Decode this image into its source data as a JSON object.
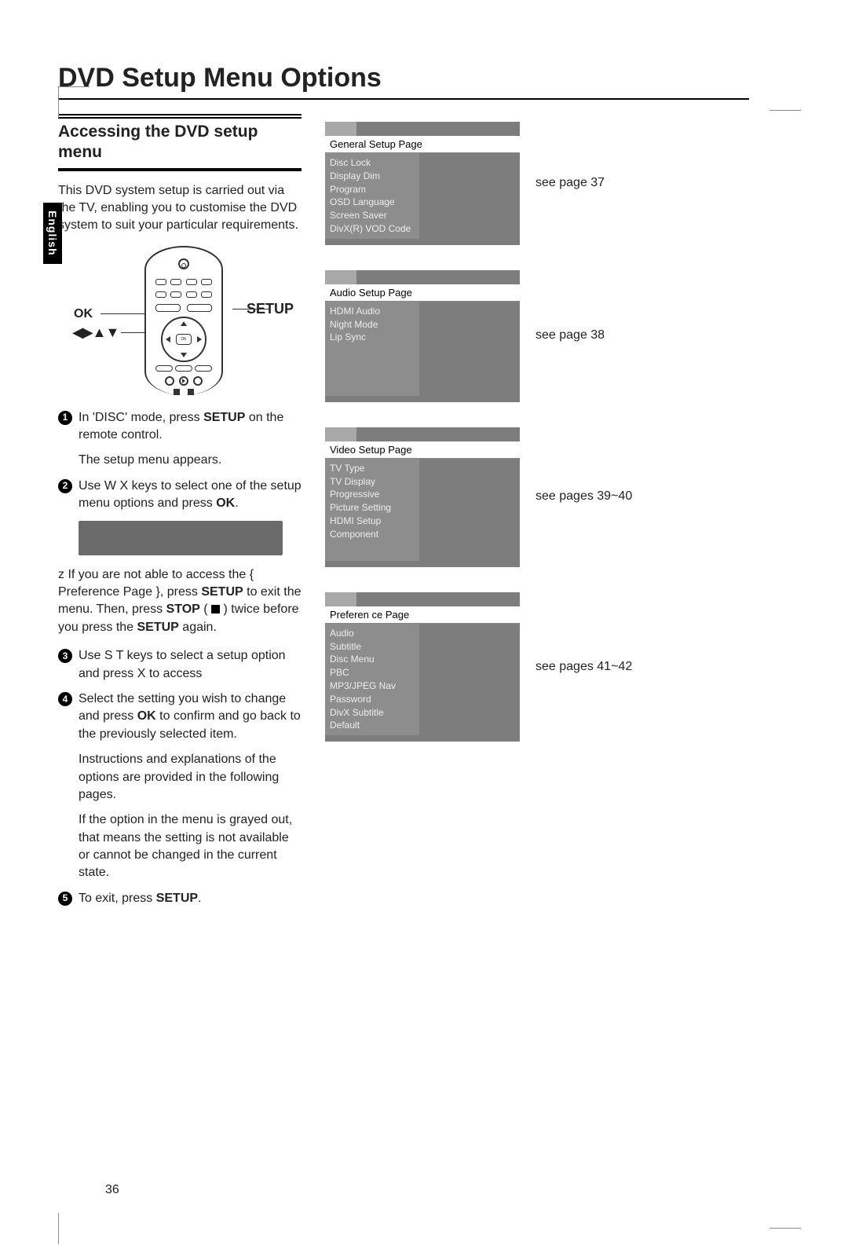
{
  "page_title": "DVD Setup Menu Options",
  "language_tab": "English",
  "section_heading": "Accessing the DVD setup menu",
  "intro": "This DVD system setup is carried out via the TV, enabling you to customise the DVD system to suit your particular requirements.",
  "remote_labels": {
    "ok": "OK",
    "setup": "SETUP",
    "arrows": "◀▶▲▼"
  },
  "steps": {
    "s1a": "In 'DISC' mode, press ",
    "s1b": "SETUP",
    "s1c": " on the remote control.",
    "s1_sub": "The setup menu appears.",
    "s2a": "Use  W X keys to select one of the setup menu options and press ",
    "s2b": "OK",
    "s2c": ".",
    "tip_pref": "z",
    "tip_a": " If you are not able to access the { Preference Page }, press ",
    "tip_b": "SETUP",
    "tip_c": " to exit the menu.  Then, press ",
    "tip_d": "STOP",
    "tip_e": " ( ",
    "tip_f": " ) twice before you press the ",
    "tip_g": "SETUP",
    "tip_h": " again.",
    "s3": "Use  S  T keys to select a setup option and press  X to access",
    "s4a": "Select the setting you wish to change and press ",
    "s4b": "OK",
    "s4c": " to confirm and go back to the previously selected item.",
    "s4_sub1": "Instructions and explanations of the options are provided in the following pages.",
    "s4_sub2": "If the option in the menu is grayed out, that means the setting is not available or cannot be changed in the current state.",
    "s5a": "To exit, press ",
    "s5b": "SETUP",
    "s5c": "."
  },
  "menus": {
    "general": {
      "title": "General Setup Page",
      "items": [
        "Disc Lock",
        "Display Dim",
        "Program",
        "OSD Language",
        "Screen Saver",
        "DivX(R) VOD Code"
      ],
      "ref": "see page 37"
    },
    "audio": {
      "title": "Audio Setup Page",
      "items": [
        "HDMI Audio",
        "Night Mode",
        "Lip Sync"
      ],
      "ref": "see page 38"
    },
    "video": {
      "title": "Video Setup Page",
      "items": [
        "TV Type",
        "TV Display",
        "Progressive",
        "Picture Setting",
        "HDMI Setup",
        "Component"
      ],
      "ref": "see pages 39~40"
    },
    "pref": {
      "title": "Preferen ce Page",
      "items": [
        "Audio",
        "Subtitle",
        "Disc Menu",
        "PBC",
        "MP3/JPEG Nav",
        "Password",
        "DivX Subtitle",
        "Default"
      ],
      "ref": "see pages 41~42"
    }
  },
  "page_number": "36"
}
